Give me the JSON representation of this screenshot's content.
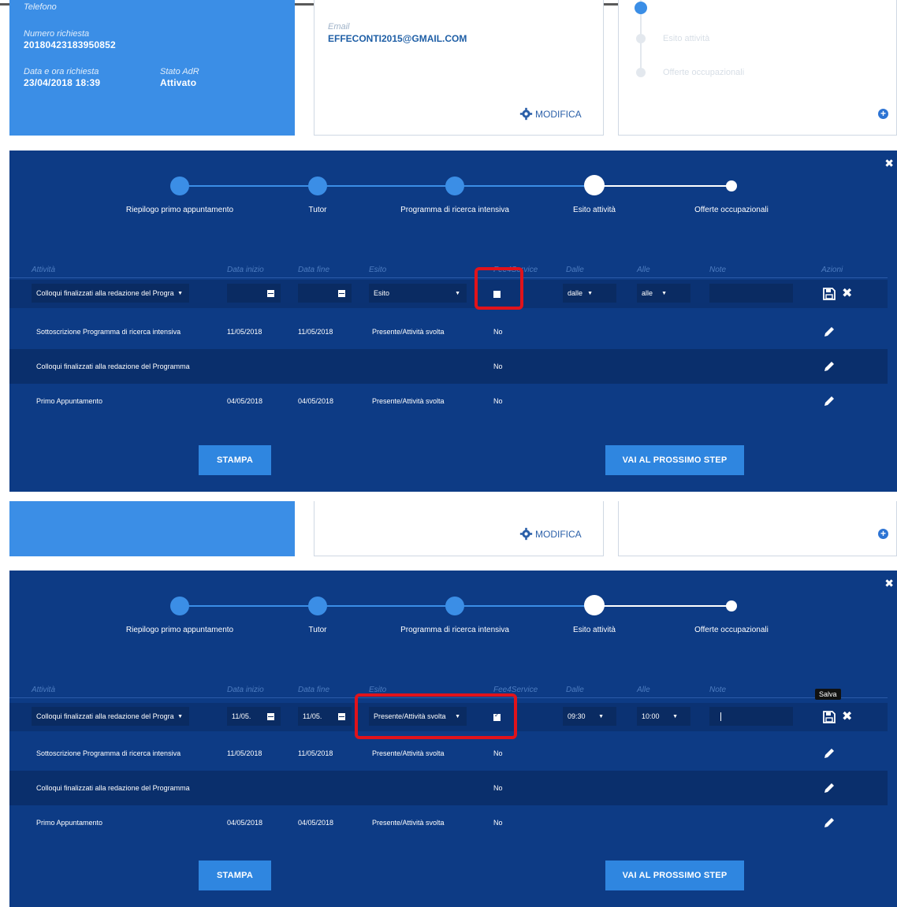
{
  "colors": {
    "panel_bg": "#0d3b85",
    "accent_blue": "#3b8ee6",
    "button_blue": "#2f86e0",
    "highlight_red": "#e0131b"
  },
  "info": {
    "telefono_label": "Telefono",
    "numero_label": "Numero richiesta",
    "numero_value": "20180423183950852",
    "data_label": "Data e ora richiesta",
    "data_value": "23/04/2018 18:39",
    "stato_label": "Stato AdR",
    "stato_value": "Attivato",
    "email_label": "Email",
    "email_value": "EFFECONTI2015@GMAIL.COM",
    "modifica": "MODIFICA",
    "mini_steps": [
      "Esito attività",
      "Offerte occupazionali"
    ]
  },
  "stepper": {
    "steps": [
      "Riepilogo primo appuntamento",
      "Tutor",
      "Programma di ricerca intensiva",
      "Esito attività",
      "Offerte occupazionali"
    ]
  },
  "table": {
    "headers": [
      "Attività",
      "Data inizio",
      "Data fine",
      "Esito",
      "Fee4Service",
      "Dalle",
      "Alle",
      "Note",
      "Azioni"
    ],
    "rows": [
      {
        "attivita": "Sottoscrizione Programma di ricerca intensiva",
        "inizio": "11/05/2018",
        "fine": "11/05/2018",
        "esito": "Presente/Attività svolta",
        "fee": "No"
      },
      {
        "attivita": "Colloqui finalizzati alla redazione del Programma",
        "inizio": "",
        "fine": "",
        "esito": "",
        "fee": "No"
      },
      {
        "attivita": "Primo Appuntamento",
        "inizio": "04/05/2018",
        "fine": "04/05/2018",
        "esito": "Presente/Attività svolta",
        "fee": "No"
      }
    ]
  },
  "edit1": {
    "attivita": "Colloqui finalizzati alla redazione del Progra",
    "inizio": "",
    "fine": "",
    "esito": "Esito",
    "dalle": "dalle",
    "alle": "alle"
  },
  "edit2": {
    "attivita": "Colloqui finalizzati alla redazione del Progra",
    "inizio": "11/05.",
    "fine": "11/05.",
    "esito": "Presente/Attività svolta",
    "dalle": "09:30",
    "alle": "10:00",
    "tooltip": "Salva"
  },
  "buttons": {
    "stampa": "STAMPA",
    "next": "VAI AL PROSSIMO STEP"
  }
}
